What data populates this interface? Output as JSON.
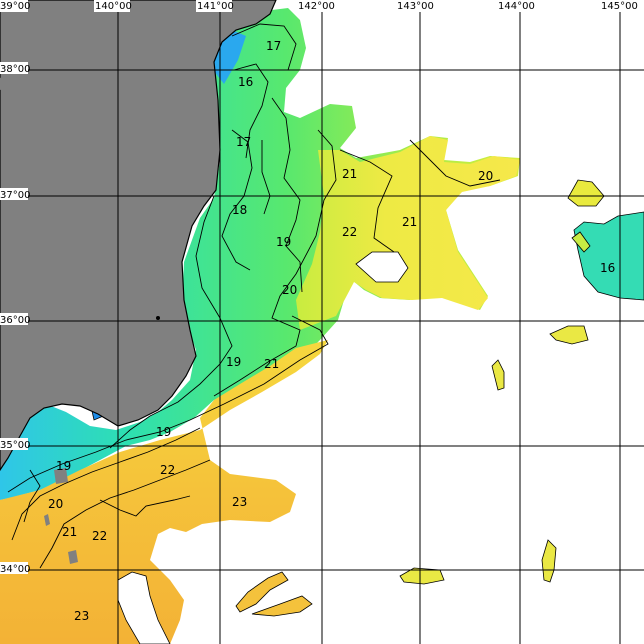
{
  "map": {
    "longitude_labels": [
      "39°00",
      "140°00",
      "141°00",
      "142°00",
      "143°00",
      "144°00",
      "145°00"
    ],
    "latitude_labels": [
      "38°00",
      "37°00",
      "36°00",
      "35°00",
      "34°00"
    ],
    "contour_labels": [
      "17",
      "16",
      "17",
      "21",
      "20",
      "18",
      "19",
      "22",
      "21",
      "16",
      "20",
      "21",
      "19",
      "19",
      "22",
      "20",
      "23",
      "21",
      "22",
      "23"
    ]
  },
  "colors": {
    "land": "#808080",
    "sst_16": "#2fc6e8",
    "sst_17": "#2ee0b0",
    "sst_18": "#58e86e",
    "sst_19": "#a8ec48",
    "sst_20": "#d8ee3c",
    "sst_21": "#f4e848",
    "sst_22": "#f8d23a",
    "sst_23": "#f4ba38",
    "cold": "#1e8ce8"
  }
}
